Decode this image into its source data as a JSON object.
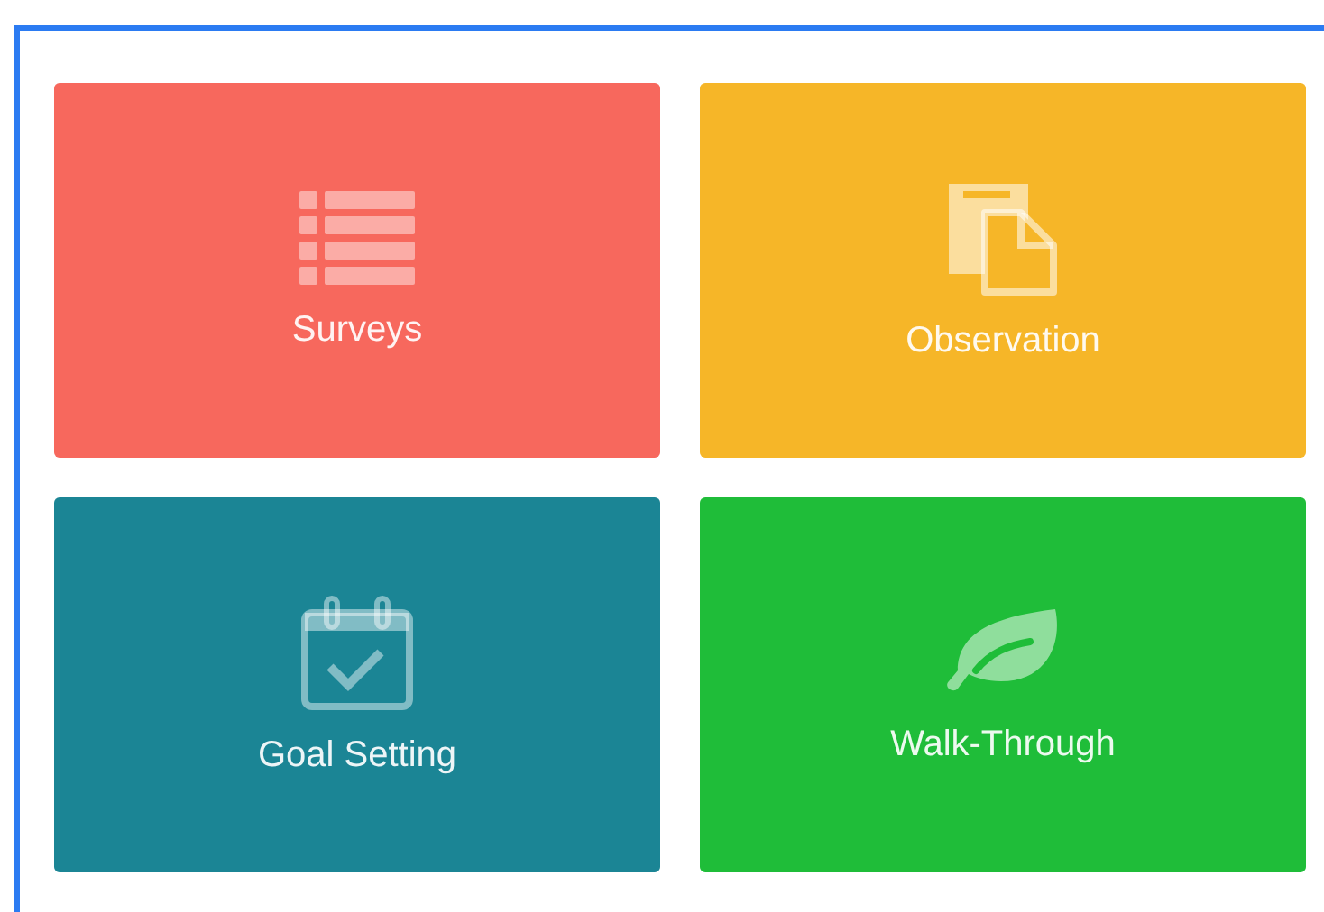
{
  "tiles": [
    {
      "label": "Surveys",
      "kind": "list",
      "color": "#f7685d"
    },
    {
      "label": "Observation",
      "kind": "documents",
      "color": "#f6b628"
    },
    {
      "label": "Goal Setting",
      "kind": "calendar",
      "color": "#1b8595"
    },
    {
      "label": "Walk-Through",
      "kind": "leaf",
      "color": "#1fbd39"
    }
  ]
}
